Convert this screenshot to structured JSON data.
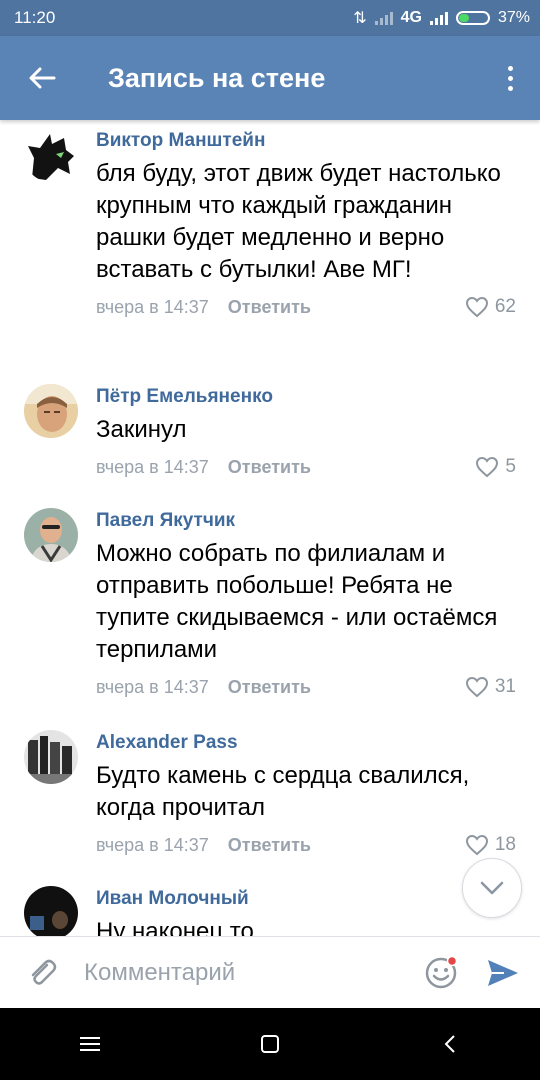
{
  "status_bar": {
    "time": "11:20",
    "network": "4G",
    "battery_percent": "37%",
    "battery_level": 0.37
  },
  "header": {
    "title": "Запись на стене"
  },
  "comments": [
    {
      "author": "Виктор Манштейн",
      "text": "бля буду, этот движ будет настолько крупным что каждый гражданин рашки будет медленно и верно вставать с бутылки! Аве МГ!",
      "time": "вчера в 14:37",
      "reply_label": "Ответить",
      "likes": "62"
    },
    {
      "author": "Пётр Емельяненко",
      "text": "Закинул",
      "time": "вчера в 14:37",
      "reply_label": "Ответить",
      "likes": "5"
    },
    {
      "author": "Павел Якутчик",
      "text": "Можно собрать по филиалам и отправить побольше! Ребята не тупите скидываемся - или остаёмся терпилами",
      "time": "вчера в 14:37",
      "reply_label": "Ответить",
      "likes": "31"
    },
    {
      "author": "Alexander Pass",
      "text": "Будто камень с сердца свалился, когда прочитал",
      "time": "вчера в 14:37",
      "reply_label": "Ответить",
      "likes": "18"
    },
    {
      "author": "Иван Молочный",
      "text": "Ну наконец то"
    }
  ],
  "compose": {
    "placeholder": "Комментарий"
  },
  "icons": {
    "back": "arrow-left-icon",
    "more": "more-vertical-icon",
    "like": "heart-outline-icon",
    "scroll_down": "chevron-down-icon",
    "attach": "paperclip-icon",
    "emoji": "smiley-icon",
    "send": "send-icon",
    "nav_menu": "menu-icon",
    "nav_home": "square-icon",
    "nav_back": "chevron-left-icon"
  },
  "colors": {
    "header_bg": "#5b84b6",
    "status_bg": "#4f74a0",
    "author": "#3f6a9b",
    "meta": "#9aa3ad",
    "send": "#5181b8",
    "notification_dot": "#e64646"
  }
}
